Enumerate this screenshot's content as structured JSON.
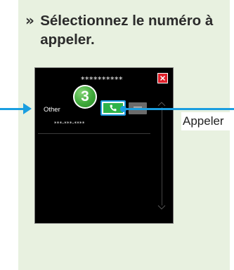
{
  "instruction": {
    "chevron": "»",
    "text": "Sélectionnez le numéro à appeler."
  },
  "screen": {
    "masked_name": "**********",
    "contact": {
      "label": "Other",
      "number": "***-***-****"
    },
    "icons": {
      "close": "close-icon",
      "call": "phone-icon",
      "message": "message-icon",
      "scroll_up": "chevron-up-icon",
      "scroll_down": "chevron-down-icon"
    }
  },
  "step_badge": {
    "number": "3"
  },
  "callout": {
    "label": "Appeler"
  },
  "colors": {
    "panel_bg": "#e8f1e0",
    "accent_blue": "#1a9ee0",
    "call_green": "#2fb34a",
    "close_red": "#e0202a",
    "step_green": "#3fa83a"
  }
}
